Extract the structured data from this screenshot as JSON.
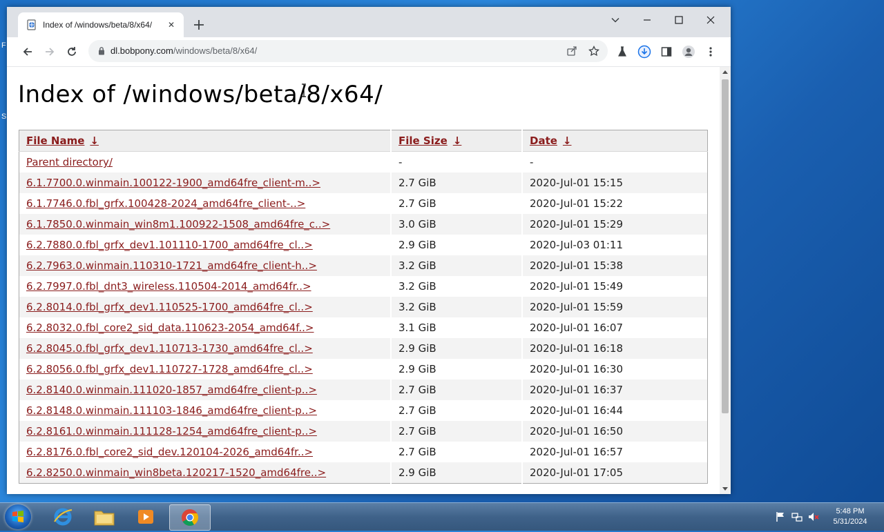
{
  "desktop": {
    "edge_letters": [
      "F",
      "S"
    ]
  },
  "browser": {
    "tab": {
      "title": "Index of /windows/beta/8/x64/"
    },
    "address": {
      "host": "dl.bobpony.com",
      "path": "/windows/beta/8/x64/"
    },
    "icons": {
      "back": "back-arrow-icon",
      "forward": "forward-arrow-icon",
      "reload": "reload-icon",
      "share": "share-icon",
      "bookmark": "star-icon",
      "labs": "flask-icon",
      "download": "download-icon",
      "sidepanel": "side-panel-icon",
      "profile": "profile-icon",
      "menu": "kebab-menu-icon"
    }
  },
  "page": {
    "title": "Index of /windows/beta/8/x64/",
    "columns": {
      "name": "File Name",
      "size": "File Size",
      "date": "Date",
      "sort_arrow": "↓"
    },
    "parent": {
      "name": "Parent directory/",
      "size": "-",
      "date": "-"
    },
    "files": [
      {
        "name": "6.1.7700.0.winmain.100122-1900_amd64fre_client-m..>",
        "size": "2.7 GiB",
        "date": "2020-Jul-01 15:15"
      },
      {
        "name": "6.1.7746.0.fbl_grfx.100428-2024_amd64fre_client-..>",
        "size": "2.7 GiB",
        "date": "2020-Jul-01 15:22"
      },
      {
        "name": "6.1.7850.0.winmain_win8m1.100922-1508_amd64fre_c..>",
        "size": "3.0 GiB",
        "date": "2020-Jul-01 15:29"
      },
      {
        "name": "6.2.7880.0.fbl_grfx_dev1.101110-1700_amd64fre_cl..>",
        "size": "2.9 GiB",
        "date": "2020-Jul-03 01:11"
      },
      {
        "name": "6.2.7963.0.winmain.110310-1721_amd64fre_client-h..>",
        "size": "3.2 GiB",
        "date": "2020-Jul-01 15:38"
      },
      {
        "name": "6.2.7997.0.fbl_dnt3_wireless.110504-2014_amd64fr..>",
        "size": "3.2 GiB",
        "date": "2020-Jul-01 15:49"
      },
      {
        "name": "6.2.8014.0.fbl_grfx_dev1.110525-1700_amd64fre_cl..>",
        "size": "3.2 GiB",
        "date": "2020-Jul-01 15:59"
      },
      {
        "name": "6.2.8032.0.fbl_core2_sid_data.110623-2054_amd64f..>",
        "size": "3.1 GiB",
        "date": "2020-Jul-01 16:07"
      },
      {
        "name": "6.2.8045.0.fbl_grfx_dev1.110713-1730_amd64fre_cl..>",
        "size": "2.9 GiB",
        "date": "2020-Jul-01 16:18"
      },
      {
        "name": "6.2.8056.0.fbl_grfx_dev1.110727-1728_amd64fre_cl..>",
        "size": "2.9 GiB",
        "date": "2020-Jul-01 16:30"
      },
      {
        "name": "6.2.8140.0.winmain.111020-1857_amd64fre_client-p..>",
        "size": "2.7 GiB",
        "date": "2020-Jul-01 16:37"
      },
      {
        "name": "6.2.8148.0.winmain.111103-1846_amd64fre_client-p..>",
        "size": "2.7 GiB",
        "date": "2020-Jul-01 16:44"
      },
      {
        "name": "6.2.8161.0.winmain.111128-1254_amd64fre_client-p..>",
        "size": "2.7 GiB",
        "date": "2020-Jul-01 16:50"
      },
      {
        "name": "6.2.8176.0.fbl_core2_sid_dev.120104-2026_amd64fr..>",
        "size": "2.7 GiB",
        "date": "2020-Jul-01 16:57"
      },
      {
        "name": "6.2.8250.0.winmain_win8beta.120217-1520_amd64fre..>",
        "size": "2.9 GiB",
        "date": "2020-Jul-01 17:05"
      }
    ],
    "link_color": "#8a1c1c"
  },
  "taskbar": {
    "items": [
      "internet-explorer-icon",
      "file-explorer-icon",
      "media-player-icon",
      "chrome-icon"
    ],
    "active_item": "chrome-icon",
    "clock": {
      "time": "5:48 PM",
      "date": "5/31/2024"
    }
  }
}
